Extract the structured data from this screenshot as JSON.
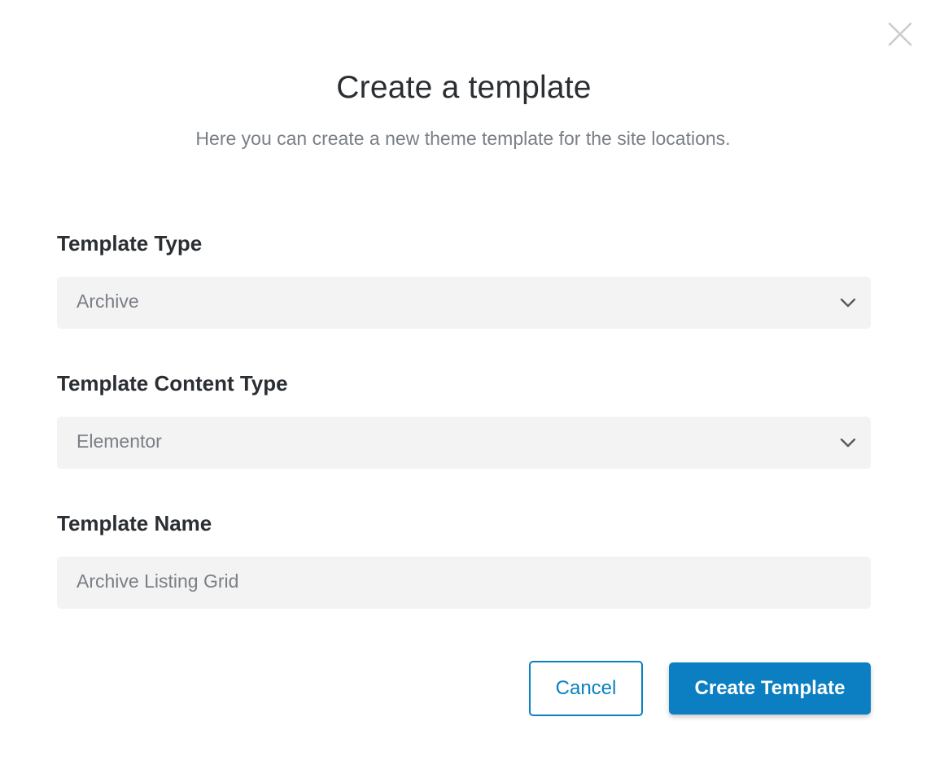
{
  "dialog": {
    "title": "Create a template",
    "subtitle": "Here you can create a new theme template for the site locations."
  },
  "fields": {
    "template_type": {
      "label": "Template Type",
      "value": "Archive"
    },
    "content_type": {
      "label": "Template Content Type",
      "value": "Elementor"
    },
    "template_name": {
      "label": "Template Name",
      "value": "Archive Listing Grid"
    }
  },
  "actions": {
    "cancel_label": "Cancel",
    "create_label": "Create Template"
  },
  "icons": {
    "close": "close-icon",
    "select_arrow": "chevron-down-icon"
  },
  "colors": {
    "accent": "#0b7fc2",
    "field_bg": "#f3f3f4",
    "muted_text": "#7a7f85",
    "heading_text": "#2b2f33"
  }
}
